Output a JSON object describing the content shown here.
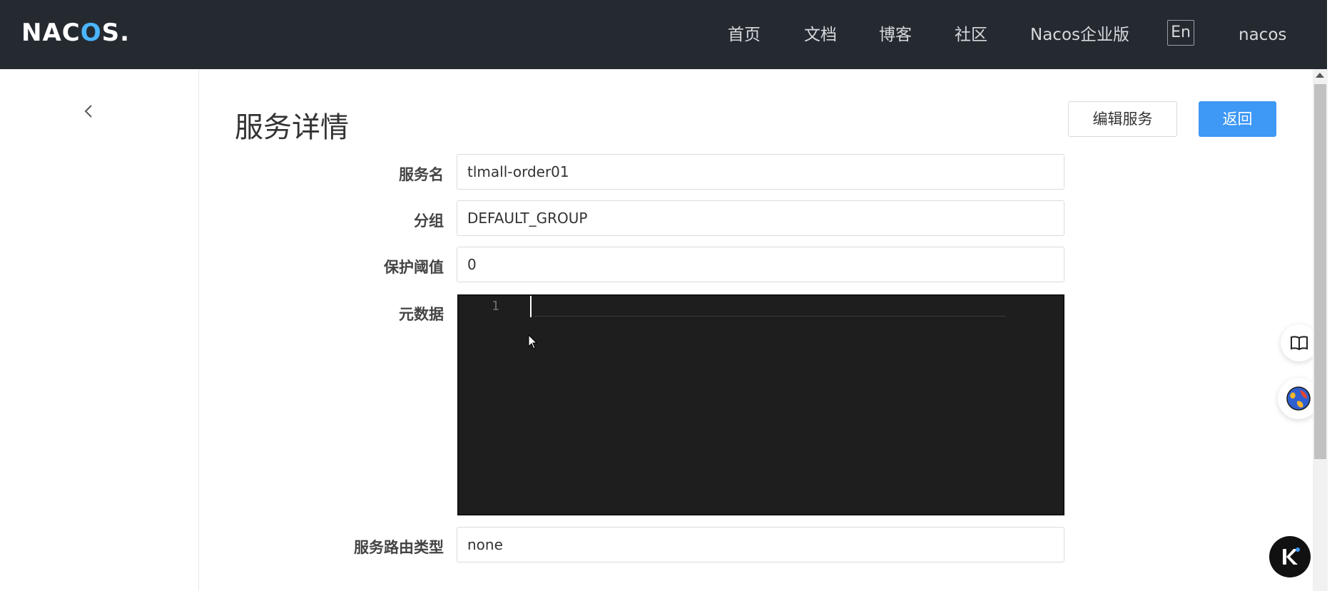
{
  "header": {
    "logo_main": "NAC",
    "logo_o": "O",
    "logo_tail": "S.",
    "nav": [
      {
        "label": "首页"
      },
      {
        "label": "文档"
      },
      {
        "label": "博客"
      },
      {
        "label": "社区"
      },
      {
        "label": "Nacos企业版"
      }
    ],
    "lang": "En",
    "user": "nacos"
  },
  "page": {
    "title": "服务详情",
    "edit_button": "编辑服务",
    "back_button": "返回"
  },
  "form": {
    "service_name_label": "服务名",
    "service_name_value": "tlmall-order01",
    "group_label": "分组",
    "group_value": "DEFAULT_GROUP",
    "threshold_label": "保护阈值",
    "threshold_value": "0",
    "metadata_label": "元数据",
    "metadata_line_number": "1",
    "route_type_label": "服务路由类型",
    "route_type_value": "none"
  },
  "colors": {
    "header_bg": "#252a31",
    "primary": "#3e98f5",
    "editor_bg": "#1e1e1e"
  },
  "icons": {
    "back": "chevron-left-icon",
    "book": "book-icon",
    "globe": "globe-icon",
    "assistant": "k-assistant-icon"
  }
}
